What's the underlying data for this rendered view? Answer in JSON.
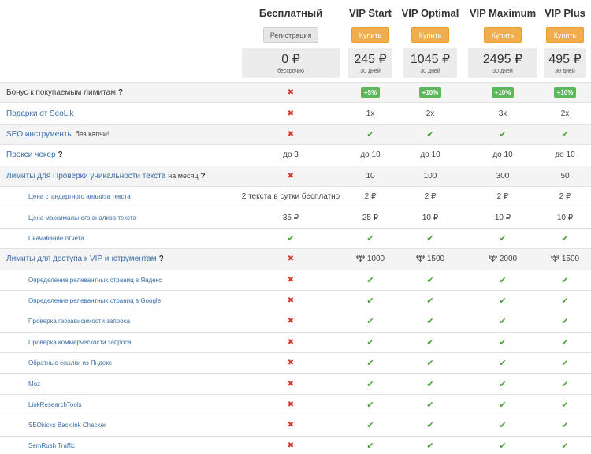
{
  "plans": [
    {
      "name": "Бесплатный",
      "button": "Регистрация",
      "price": "0 ₽",
      "period": "бессрочно"
    },
    {
      "name": "VIP Start",
      "button": "Купить",
      "price": "245 ₽",
      "period": "30 дней"
    },
    {
      "name": "VIP Optimal",
      "button": "Купить",
      "price": "1045 ₽",
      "period": "30 дней"
    },
    {
      "name": "VIP Maximum",
      "button": "Купить",
      "price": "2495 ₽",
      "period": "30 дней"
    },
    {
      "name": "VIP Plus",
      "button": "Купить",
      "price": "495 ₽",
      "period": "30 дней"
    }
  ],
  "rows": [
    {
      "label": "Бонус к покупаемым лимитам",
      "type": "main",
      "help": true,
      "cells": [
        "✖",
        "+5%",
        "+10%",
        "+10%",
        "+10%"
      ]
    },
    {
      "label": "Подарки от SeoLik",
      "type": "main",
      "cells": [
        "✖",
        "1x",
        "2x",
        "3x",
        "2x"
      ]
    },
    {
      "label": "SEO инструменты",
      "suffix": "без капчи!",
      "type": "main",
      "cells": [
        "✖",
        "✔",
        "✔",
        "✔",
        "✔"
      ]
    },
    {
      "label": "Прокси чекер",
      "type": "main",
      "help": true,
      "cells": [
        "до 3",
        "до 10",
        "до 10",
        "до 10",
        "до 10"
      ]
    },
    {
      "label": "Лимиты для Проверки уникальности текста",
      "suffix": "на месяц",
      "type": "main",
      "help": true,
      "cells": [
        "✖",
        "10",
        "100",
        "300",
        "50"
      ]
    },
    {
      "label": "Цена стандартного анализа текста",
      "type": "sub",
      "cells": [
        "2 текста в сутки бесплатно",
        "2 ₽",
        "2 ₽",
        "2 ₽",
        "2 ₽"
      ]
    },
    {
      "label": "Цена максимального анализа текста",
      "type": "sub",
      "cells": [
        "35 ₽",
        "25 ₽",
        "10 ₽",
        "10 ₽",
        "10 ₽"
      ]
    },
    {
      "label": "Скачивание отчета",
      "type": "sub",
      "cells": [
        "✔",
        "✔",
        "✔",
        "✔",
        "✔"
      ]
    },
    {
      "label": "Лимиты для доступа к VIP инструментам",
      "type": "main",
      "help": true,
      "cells": [
        "✖",
        "1000",
        "1500",
        "2000",
        "1500"
      ]
    },
    {
      "label": "Определение релевантных страниц в Яндекс",
      "type": "sub",
      "cells": [
        "✖",
        "✔",
        "✔",
        "✔",
        "✔"
      ]
    },
    {
      "label": "Определение релевантных страниц в Google",
      "type": "sub",
      "cells": [
        "✖",
        "✔",
        "✔",
        "✔",
        "✔"
      ]
    },
    {
      "label": "Проверка геозависимости запроса",
      "type": "sub",
      "cells": [
        "✖",
        "✔",
        "✔",
        "✔",
        "✔"
      ]
    },
    {
      "label": "Проверка коммерческости запроса",
      "type": "sub",
      "cells": [
        "✖",
        "✔",
        "✔",
        "✔",
        "✔"
      ]
    },
    {
      "label": "Обратные ссылки из Яндекс",
      "type": "sub",
      "cells": [
        "✖",
        "✔",
        "✔",
        "✔",
        "✔"
      ]
    },
    {
      "label": "Moz",
      "type": "sub",
      "cells": [
        "✖",
        "✔",
        "✔",
        "✔",
        "✔"
      ]
    },
    {
      "label": "LinkResearchTools",
      "type": "sub",
      "cells": [
        "✖",
        "✔",
        "✔",
        "✔",
        "✔"
      ]
    },
    {
      "label": "SEOkicks Backlink Checker",
      "type": "sub",
      "cells": [
        "✖",
        "✔",
        "✔",
        "✔",
        "✔"
      ]
    },
    {
      "label": "SemRush Traffic",
      "type": "sub",
      "cells": [
        "✖",
        "✔",
        "✔",
        "✔",
        "✔"
      ]
    }
  ],
  "help_icon": "?",
  "icons": {
    "yes": "check-icon",
    "no": "cross-icon",
    "diamond": "diamond-icon"
  },
  "colors": {
    "buy": "#f0ad4e",
    "badge": "#5cb85c",
    "check": "#4ca23a",
    "cross": "#d9342b",
    "link": "#3a6ea5"
  }
}
